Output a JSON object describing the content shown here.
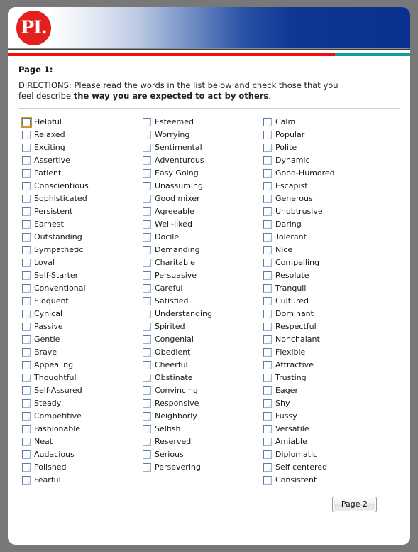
{
  "window": {
    "background_color": "#787878",
    "sheet_color": "#ffffff"
  },
  "header": {
    "logo_text": "PI",
    "logo_dot": ".",
    "logo_color": "#e3201d",
    "gradient_start_color": "#ffffff",
    "gradient_end_color": "#0b3190",
    "rule_color": "#3a3a3a",
    "accent_bar_red": "#f60b0b",
    "accent_bar_teal": "#129c9c"
  },
  "main": {
    "page_label": "Page 1:",
    "directions_prefix": "DIRECTIONS: Please read the words in the list below and check those that you feel describe ",
    "directions_emphasis": "the way you are expected to act by others",
    "directions_suffix": ".",
    "columns": [
      {
        "items": [
          "Helpful",
          "Relaxed",
          "Exciting",
          "Assertive",
          "Patient",
          "Conscientious",
          "Sophisticated",
          "Persistent",
          "Earnest",
          "Outstanding",
          "Sympathetic",
          "Loyal",
          "Self-Starter",
          "Conventional",
          "Eloquent",
          "Cynical",
          "Passive",
          "Gentle",
          "Brave",
          "Appealing",
          "Thoughtful",
          "Self-Assured",
          "Steady",
          "Competitive",
          "Fashionable",
          "Neat",
          "Audacious",
          "Polished",
          "Fearful"
        ]
      },
      {
        "items": [
          "Esteemed",
          "Worrying",
          "Sentimental",
          "Adventurous",
          "Easy Going",
          "Unassuming",
          "Good mixer",
          "Agreeable",
          "Well-liked",
          "Docile",
          "Demanding",
          "Charitable",
          "Persuasive",
          "Careful",
          "Satisfied",
          "Understanding",
          "Spirited",
          "Congenial",
          "Obedient",
          "Cheerful",
          "Obstinate",
          "Convincing",
          "Responsive",
          "Neighborly",
          "Selfish",
          "Reserved",
          "Serious",
          "Persevering"
        ]
      },
      {
        "items": [
          "Calm",
          "Popular",
          "Polite",
          "Dynamic",
          "Good-Humored",
          "Escapist",
          "Generous",
          "Unobtrusive",
          "Daring",
          "Tolerant",
          "Nice",
          "Compelling",
          "Resolute",
          "Tranquil",
          "Cultured",
          "Dominant",
          "Respectful",
          "Nonchalant",
          "Flexible",
          "Attractive",
          "Trusting",
          "Eager",
          "Shy",
          "Fussy",
          "Versatile",
          "Amiable",
          "Diplomatic",
          "Self centered",
          "Consistent"
        ]
      }
    ],
    "focused_checkbox": "Helpful",
    "focus_ring_color": "#cb9a2a"
  },
  "footer": {
    "next_page_label": "Page 2"
  }
}
